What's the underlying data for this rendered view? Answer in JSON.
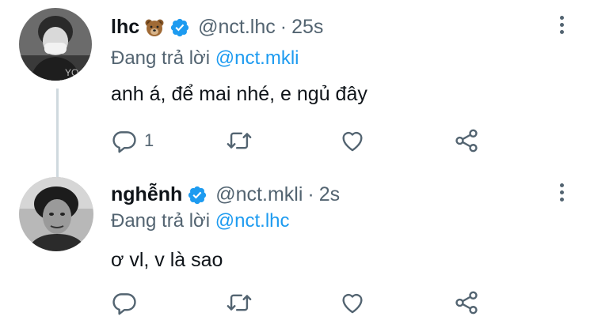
{
  "tweets": [
    {
      "name": "lhc",
      "name_emoji_icon": "bear-face-icon",
      "handle": "@nct.lhc",
      "separator": "·",
      "time": "25s",
      "replying_label": "Đang trả lời",
      "replying_to": "@nct.mkli",
      "text": "anh á, để mai nhé, e ngủ đây",
      "reply_count": "1",
      "retweet_count": "",
      "like_count": ""
    },
    {
      "name": "nghễnh",
      "handle": "@nct.mkli",
      "separator": "·",
      "time": "2s",
      "replying_label": "Đang trả lời",
      "replying_to": "@nct.lhc",
      "text": "ơ vl, v là sao",
      "reply_count": "",
      "retweet_count": "",
      "like_count": ""
    }
  ],
  "colors": {
    "accent": "#1d9bf0",
    "secondary_text": "#536471",
    "thread_line": "#cfd9de"
  },
  "icons": [
    "reply-icon",
    "retweet-icon",
    "like-icon",
    "share-icon",
    "verified-badge-icon",
    "more-options-icon"
  ]
}
